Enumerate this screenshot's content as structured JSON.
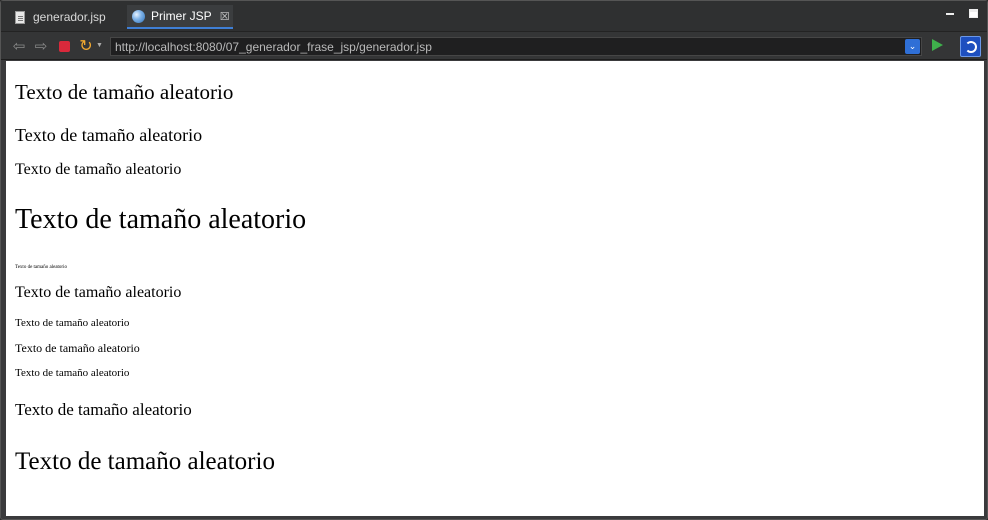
{
  "tabs": [
    {
      "label": "generador.jsp",
      "icon": "jsp-file-icon"
    },
    {
      "label": "Primer JSP",
      "icon": "globe-icon",
      "close": "☒"
    }
  ],
  "toolbar": {
    "back": "⇦",
    "forward": "⇨",
    "refresh": "↻",
    "url": "http://localhost:8080/07_generador_frase_jsp/generador.jsp"
  },
  "content": {
    "lines": [
      "Texto de tamaño aleatorio",
      "Texto de tamaño aleatorio",
      "Texto de tamaño aleatorio",
      "Texto de tamaño aleatorio",
      "Texto de tamaño aleatorio",
      "Texto de tamaño aleatorio",
      "Texto de tamaño aleatorio",
      "Texto de tamaño aleatorio",
      "Texto de tamaño aleatorio",
      "Texto de tamaño aleatorio",
      "Texto de tamaño aleatorio"
    ]
  },
  "colors": {
    "accent": "#3f7fd6",
    "stop": "#d9293b",
    "go": "#3fb14c"
  }
}
